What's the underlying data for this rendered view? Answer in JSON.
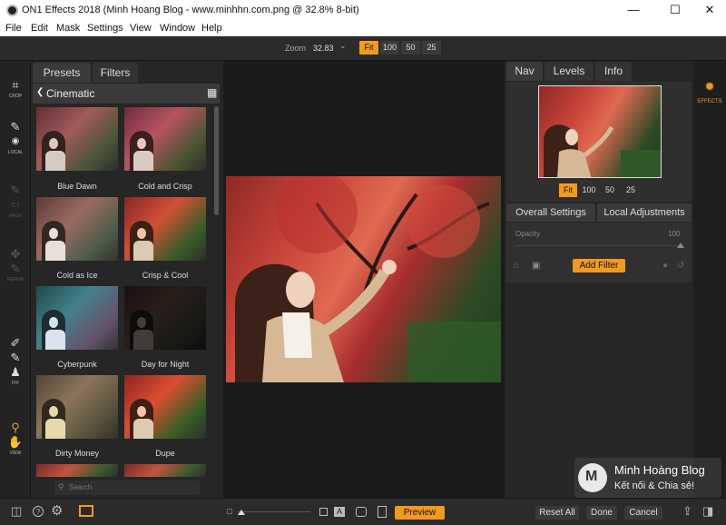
{
  "window": {
    "title": "ON1 Effects 2018 (Minh Hoang Blog - www.minhhn.com.png @ 32.8% 8-bit)",
    "minimize": "—",
    "maximize": "☐",
    "close": "✕"
  },
  "menu": [
    "File",
    "Edit",
    "Mask",
    "Settings",
    "View",
    "Window",
    "Help"
  ],
  "zoom": {
    "label": "Zoom",
    "value": "32.83",
    "chevron": "⌄",
    "buttons": [
      "Fit",
      "100",
      "50",
      "25"
    ],
    "active": "Fit"
  },
  "tools": [
    {
      "label": "CROP",
      "icon": "crop-icon",
      "glyph": "⌗"
    },
    {
      "label": "LOCAL",
      "icon": "brush-icon",
      "glyph": "✎"
    },
    {
      "label": "MASK",
      "icon": "mask-brush-icon",
      "glyph": "✎"
    },
    {
      "label": "REFINE",
      "icon": "refine-icon",
      "glyph": "✥"
    },
    {
      "label": "FIX",
      "icon": "stamp-icon",
      "glyph": "♟"
    },
    {
      "label": "VIEW",
      "icon": "zoom-icon",
      "glyph": "⚲"
    }
  ],
  "browser": {
    "tabs": [
      "Presets",
      "Filters"
    ],
    "active_tab": "Presets",
    "category": "Cinematic",
    "back_glyph": "❮",
    "grid_glyph": "▦",
    "presets": [
      "Blue Dawn",
      "Cold and Crisp",
      "Cold as Ice",
      "Crisp & Cool",
      "Cyberpunk",
      "Day for Night",
      "Dirty Money",
      "Dupe"
    ],
    "search_placeholder": "Search",
    "search_glyph": "⚲"
  },
  "right_panel": {
    "tabs": [
      "Nav",
      "Levels",
      "Info"
    ],
    "active_tab": "Nav",
    "nav_buttons": [
      "Fit",
      "100",
      "50",
      "25"
    ],
    "nav_active": "Fit",
    "settings_tabs": [
      "Overall Settings",
      "Local Adjustments"
    ],
    "opacity_label": "Opacity",
    "opacity_value": "100",
    "add_filter": "Add Filter"
  },
  "effects_module": {
    "label": "EFFECTS",
    "glyph": "✹"
  },
  "bottom": {
    "preview": "Preview",
    "reset_all": "Reset All",
    "done": "Done",
    "cancel": "Cancel",
    "help_glyph": "?",
    "gear_glyph": "⚙",
    "text_glyph": "A"
  },
  "watermark": {
    "title": "Minh Hoàng Blog",
    "subtitle": "Kết nối & Chia sẻ!",
    "logo_text": "M"
  },
  "colors": {
    "accent": "#f39a1e",
    "panel": "#262626",
    "background": "#1b1b1b"
  }
}
